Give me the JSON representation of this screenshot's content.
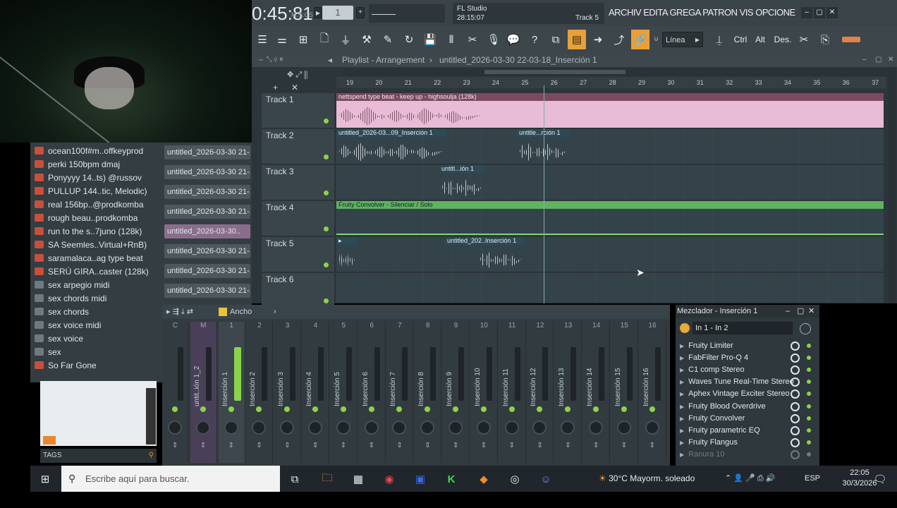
{
  "topbar": {
    "time": "0:45:81",
    "time_unit": "M:S:CS",
    "tempo_value": "1",
    "hint_line1": "FL Studio",
    "hint_line2": "28:15:07",
    "hint_track": "Track 5",
    "menus": "ARCHIV EDITA GREGA PATRON VIS OPCIONE HERRAMIENTA"
  },
  "toolbar": {
    "snap_label": "Línea",
    "ctrl_label": "Ctrl",
    "alt_label": "Alt",
    "des_label": "Des."
  },
  "playlist": {
    "title": "Playlist - Arrangement",
    "pattern": "untitled_2026-03-30 22-03-18_Inserción 1",
    "ruler": [
      "19",
      "20",
      "21",
      "22",
      "23",
      "24",
      "25",
      "26",
      "27",
      "28",
      "29",
      "30",
      "31",
      "32",
      "33",
      "34",
      "35",
      "36",
      "37"
    ],
    "tracks": [
      {
        "name": "Track 1"
      },
      {
        "name": "Track 2"
      },
      {
        "name": "Track 3"
      },
      {
        "name": "Track 4"
      },
      {
        "name": "Track 5"
      },
      {
        "name": "Track 6"
      }
    ],
    "clips": {
      "t1": "nettspend type beat - keep up - highsoulja (128k)",
      "t2a": "untitled_2026-03...09_Inserción 1",
      "t2b": "untitle...rción 1",
      "t3": "untitl...ión 1",
      "t4": "Fruity Convolver - Silenciar / Solo",
      "t5": "untitled_202..Inserción 1"
    }
  },
  "browser": {
    "files": [
      {
        "label": "ocean100f#m..offkeyprod",
        "icon": "mp3"
      },
      {
        "label": "perki 150bpm dmaj",
        "icon": "mp3"
      },
      {
        "label": "Ponyyyy 14..ts) @russov",
        "icon": "mp3"
      },
      {
        "label": "PULLUP 144..tic, Melodic)",
        "icon": "mp3"
      },
      {
        "label": "real 156bp..@prodkomba",
        "icon": "mp3"
      },
      {
        "label": "rough beau..prodkomba",
        "icon": "mp3"
      },
      {
        "label": "run to the s..7juno (128k)",
        "icon": "mp3"
      },
      {
        "label": "SA Seemles..Virtual+RnB)",
        "icon": "mp3"
      },
      {
        "label": "saramalaca..ag type beat",
        "icon": "mp3"
      },
      {
        "label": "SERÚ GIRA..caster (128k)",
        "icon": "mp3"
      },
      {
        "label": "sex arpegio midi",
        "icon": "midi"
      },
      {
        "label": "sex chords midi",
        "icon": "midi"
      },
      {
        "label": "sex chords",
        "icon": "midi"
      },
      {
        "label": "sex voice midi",
        "icon": "midi"
      },
      {
        "label": "sex voice",
        "icon": "midi"
      },
      {
        "label": "sex",
        "icon": "midi"
      },
      {
        "label": "So Far Gone",
        "icon": "mp3"
      }
    ],
    "patterns": [
      "untitled_2026-03-30 21-...",
      "untitled_2026-03-30 21-...",
      "untitled_2026-03-30 21-...",
      "untitled_2026-03-30 21-...",
      "untitled_2026-03-30..",
      "untitled_2026-03-30 21-...",
      "untitled_2026-03-30 21-...",
      "untitled_2026-03-30 21-..."
    ],
    "tags_label": "TAGS"
  },
  "mixer": {
    "view_label": "Ancho",
    "strips": [
      {
        "num": "C",
        "name": ""
      },
      {
        "num": "M",
        "name": "untit..ión 1_2"
      },
      {
        "num": "1",
        "name": "Inserción 1"
      },
      {
        "num": "2",
        "name": "Inserción 2"
      },
      {
        "num": "3",
        "name": "Inserción 3"
      },
      {
        "num": "4",
        "name": "Inserción 4"
      },
      {
        "num": "5",
        "name": "Inserción 5"
      },
      {
        "num": "6",
        "name": "Inserción 6"
      },
      {
        "num": "7",
        "name": "Inserción 7"
      },
      {
        "num": "8",
        "name": "Inserción 8"
      },
      {
        "num": "9",
        "name": "Inserción 9"
      },
      {
        "num": "10",
        "name": "Inserción 10"
      },
      {
        "num": "11",
        "name": "Inserción 11"
      },
      {
        "num": "12",
        "name": "Inserción 12"
      },
      {
        "num": "13",
        "name": "Inserción 13"
      },
      {
        "num": "14",
        "name": "Inserción 14"
      },
      {
        "num": "15",
        "name": "Inserción 15"
      },
      {
        "num": "16",
        "name": "Inserción 16"
      }
    ]
  },
  "insert_panel": {
    "title": "Mezclador - Inserción 1",
    "io": "In 1 - In 2",
    "slots": [
      "Fruity Limiter",
      "FabFilter Pro-Q 4",
      "C1 comp Stereo",
      "Waves Tune Real-Time Stereo",
      "Aphex Vintage Exciter Stereo",
      "Fruity Blood Overdrive",
      "Fruity Convolver",
      "Fruity parametric EQ",
      "Fruity Flangus",
      "Ranura 10"
    ]
  },
  "taskbar": {
    "search_placeholder": "Escribe aquí para buscar.",
    "weather": "30°C  Mayorm. soleado",
    "lang": "ESP",
    "time": "22:05",
    "date": "30/3/2026"
  }
}
